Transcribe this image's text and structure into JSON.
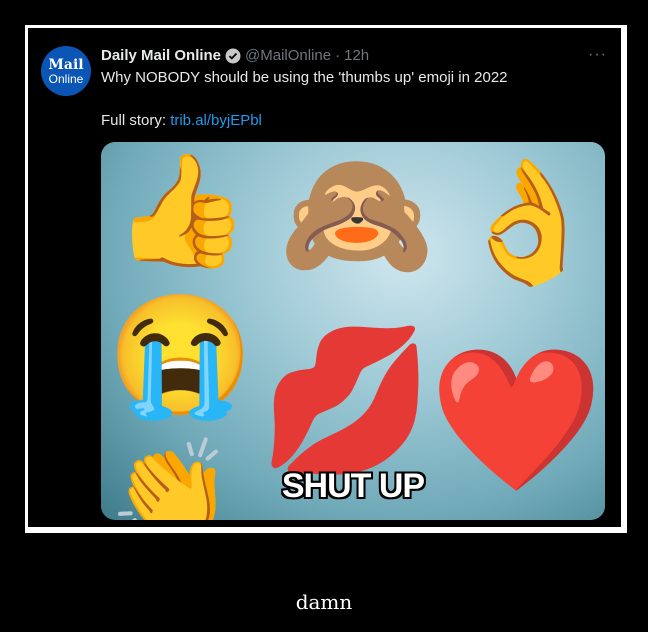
{
  "tweet": {
    "avatar_line1": "Mail",
    "avatar_line2": "Online",
    "name": "Daily Mail Online",
    "handle": "@MailOnline",
    "separator": "·",
    "time": "12h",
    "more": "···",
    "text": "Why NOBODY should be using the 'thumbs up' emoji in 2022",
    "full_story_label": "Full story:",
    "link": "trib.al/byjEPbl"
  },
  "media": {
    "overlay_text": "SHUT UP",
    "emojis": {
      "thumbs_up": "👍",
      "monkey": "🙈",
      "ok_hand": "👌",
      "crying": "😭",
      "kiss": "💋",
      "heart": "❤️",
      "clap": "👏"
    }
  },
  "caption": "damn",
  "colors": {
    "accent": "#1d9bf0",
    "avatar": "#0a55b5"
  }
}
